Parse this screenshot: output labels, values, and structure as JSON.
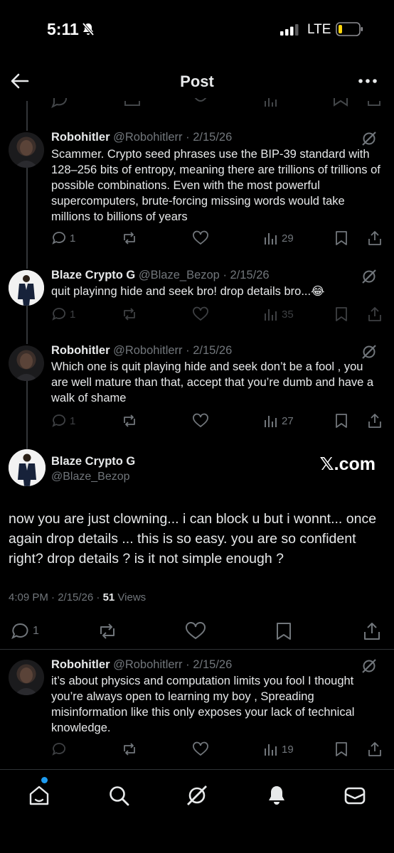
{
  "status_bar": {
    "time": "5:11",
    "network": "LTE"
  },
  "header": {
    "title": "Post"
  },
  "replies_above": [
    {
      "name": "Robohitler",
      "handle_date": "@Robohitlerr · 2/15/26",
      "text": "Scammer. Crypto seed phrases use the BIP-39 standard with 128–256 bits of entropy, meaning there are trillions of trillions of possible combinations. Even with the most powerful supercomputers, brute-forcing missing words would take millions to billions of years",
      "replies": "1",
      "views": "29"
    },
    {
      "name": "Blaze Crypto G",
      "handle_date": "@Blaze_Bezop · 2/15/26",
      "text": "quit playinng hide and seek bro! drop details bro...😂",
      "replies": "1",
      "views": "35"
    },
    {
      "name": "Robohitler",
      "handle_date": "@Robohitlerr · 2/15/26",
      "text": "Which one is quit playing hide and seek don’t be a fool , you are well mature than that, accept that you’re dumb and have a walk of shame",
      "replies": "1",
      "views": "27"
    }
  ],
  "main_post": {
    "name": "Blaze Crypto G",
    "handle": "@Blaze_Bezop",
    "watermark": "𝕏.com",
    "text": "now you are just clowning... i can block u but i wonnt... once again drop details ... this is so easy. you are so confident right? drop details ? is it not simple enough ?",
    "time_date": "4:09 PM · 2/15/26 · ",
    "views_count": "51",
    "views_label": " Views",
    "replies": "1"
  },
  "reply_below": {
    "name": "Robohitler",
    "handle_date": "@Robohitlerr · 2/15/26",
    "text": "it’s about physics and computation limits you fool I thought you’re always open to learning my boy , Spreading misinformation like this only exposes your lack of technical knowledge.",
    "views": "19"
  },
  "colors": {
    "background": "#000000",
    "text": "#e7e9ea",
    "muted": "#71767b",
    "accent": "#1d9bf0",
    "divider": "#2f3336"
  },
  "icons": {
    "nav": [
      "home-icon",
      "search-icon",
      "grok-icon",
      "notifications-icon",
      "messages-icon"
    ]
  }
}
